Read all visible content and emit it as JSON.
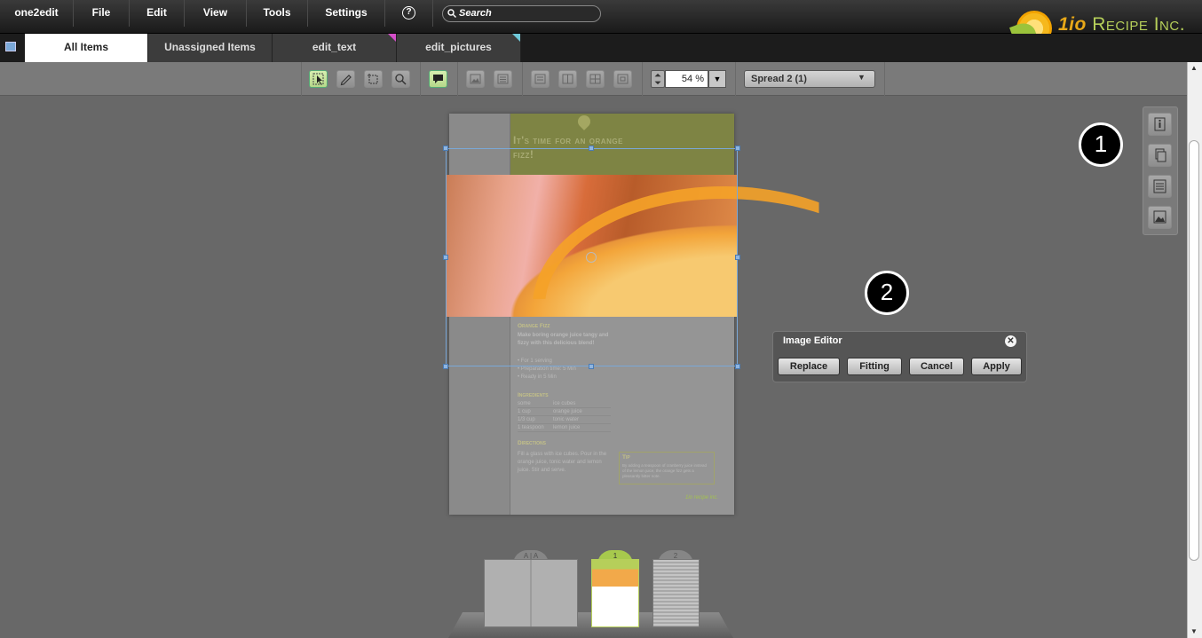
{
  "menubar": {
    "items": [
      "one2edit",
      "File",
      "Edit",
      "View",
      "Tools",
      "Settings"
    ],
    "help_label": "?",
    "search_placeholder": "Search"
  },
  "logo": {
    "brand": "1io",
    "text": "Recipe Inc."
  },
  "tabs": [
    {
      "label": "All Items",
      "active": true
    },
    {
      "label": "Unassigned Items",
      "active": false
    },
    {
      "label": "edit_text",
      "active": false,
      "marker_color": "#d44ec8"
    },
    {
      "label": "edit_pictures",
      "active": false,
      "marker_color": "#6fc8d8"
    }
  ],
  "toolbar": {
    "zoom": "54 %",
    "spread": "Spread 2 (1)"
  },
  "document": {
    "heading": "It's time for an orange fizz!",
    "recipe_title": "Orange Fizz",
    "intro": "Make boring orange juice tangy and fizzy with this delicious blend!",
    "bullets": [
      "• For 1 serving",
      "• Preparation time: 5 Min",
      "• Ready in 5 Min"
    ],
    "ingredients_title": "Ingredients",
    "ingredients": [
      {
        "qty": "some",
        "name": "ice cubes"
      },
      {
        "qty": "1 cup",
        "name": "orange juice"
      },
      {
        "qty": "1/3 cup",
        "name": "tonic water"
      },
      {
        "qty": "1 teaspoon",
        "name": "lemon juice"
      }
    ],
    "directions_title": "Directions",
    "directions": "Fill a glass with ice cubes. Pour in the orange juice, tonic water and lemon juice. Stir and serve.",
    "tip_title": "Tip",
    "tip": "By adding a teaspoon of cranberry juice instead of the lemon juice, the orange fizz gets a pleasantly bitter note.",
    "footer_logo": "1io recipe inc."
  },
  "callouts": [
    "1",
    "2"
  ],
  "image_editor": {
    "title": "Image Editor",
    "buttons": [
      "Replace",
      "Fitting",
      "Cancel",
      "Apply"
    ]
  },
  "thumbnails": [
    {
      "label": "A | A"
    },
    {
      "label": "1"
    },
    {
      "label": "2"
    }
  ]
}
